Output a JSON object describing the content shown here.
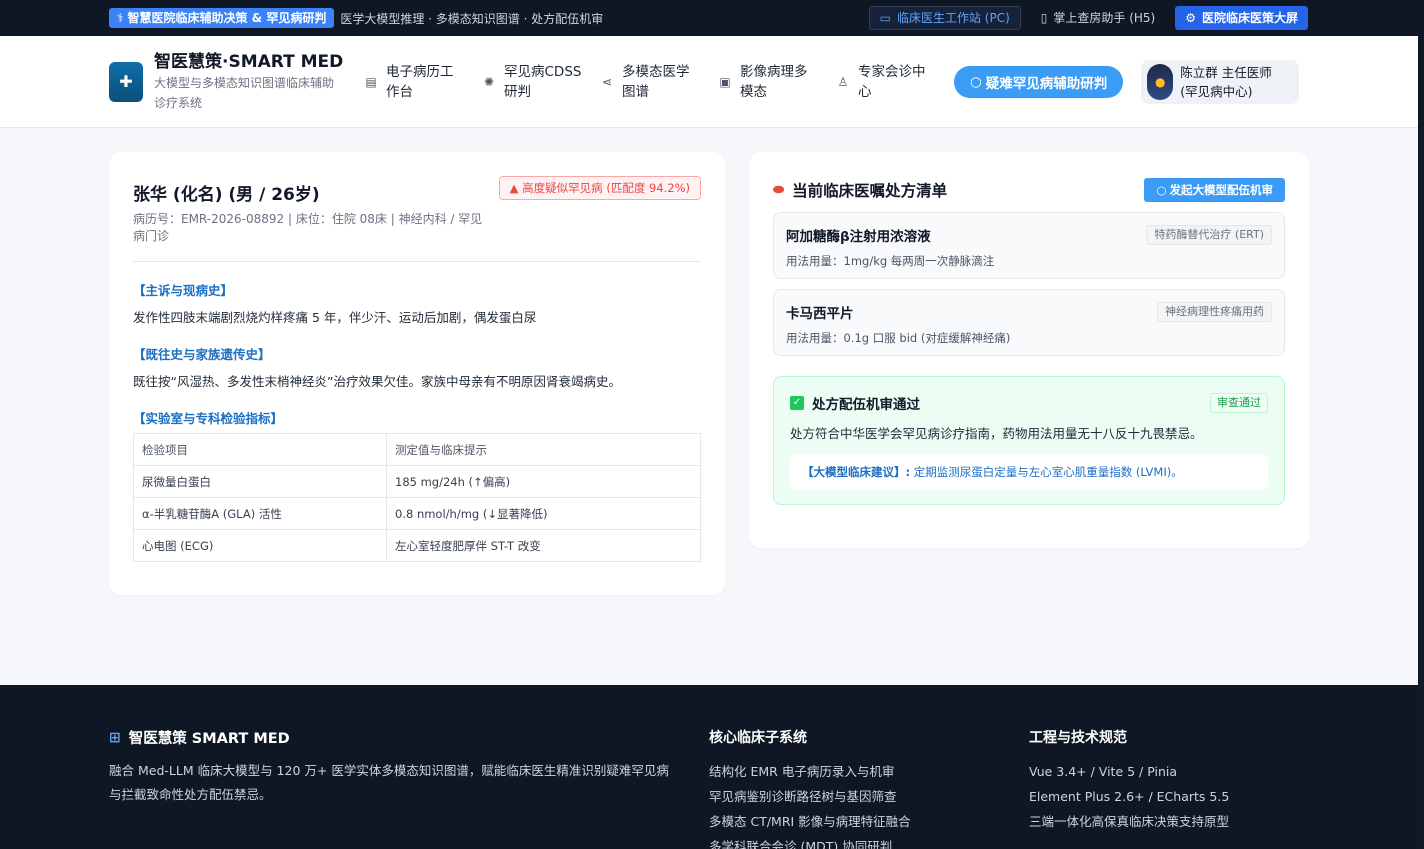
{
  "topbar": {
    "banner": "智慧医院临床辅助决策 & 罕见病研判",
    "tagline": "医学大模型推理 · 多模态知识图谱 · 处方配伍机审",
    "links": [
      {
        "label": "临床医生工作站 (PC)"
      },
      {
        "label": "掌上查房助手 (H5)"
      },
      {
        "label": "医院临床医策大屏"
      }
    ]
  },
  "header": {
    "title": "智医慧策·SMART MED",
    "subtitle": "大模型与多模态知识图谱临床辅助诊疗系统",
    "nav": [
      {
        "label": "电子病历工作台"
      },
      {
        "label": "罕见病CDSS研判"
      },
      {
        "label": "多模态医学图谱"
      },
      {
        "label": "影像病理多模态"
      },
      {
        "label": "专家会诊中心"
      }
    ],
    "cta": "疑难罕见病辅助研判",
    "user": {
      "name": "陈立群 主任医师",
      "dept": "(罕见病中心)"
    }
  },
  "patient": {
    "name": "张华 (化名) (男 / 26岁)",
    "meta": "病历号：EMR-2026-08892 | 床位：住院 08床 | 神经内科 / 罕见病门诊",
    "risk": "高度疑似罕见病 (匹配度 94.2%)",
    "sections": [
      {
        "title": "【主诉与现病史】",
        "body": "发作性四肢末端剧烈烧灼样疼痛 5 年，伴少汗、运动后加剧，偶发蛋白尿"
      },
      {
        "title": "【既往史与家族遗传史】",
        "body": "既往按“风湿热、多发性末梢神经炎”治疗效果欠佳。家族中母亲有不明原因肾衰竭病史。"
      }
    ],
    "lab_title": "【实验室与专科检验指标】",
    "lab_headers": [
      "检验项目",
      "测定值与临床提示"
    ],
    "lab_rows": [
      [
        "尿微量白蛋白",
        "185 mg/24h (↑偏高)"
      ],
      [
        "α-半乳糖苷酶A (GLA) 活性",
        "0.8 nmol/h/mg (↓显著降低)"
      ],
      [
        "心电图 (ECG)",
        "左心室轻度肥厚伴 ST-T 改变"
      ]
    ]
  },
  "prescription": {
    "title": "当前临床医嘱处方清单",
    "audit_button": "发起大模型配伍机审",
    "items": [
      {
        "name": "阿加糖酶β注射用浓溶液",
        "usage": "用法用量：1mg/kg 每两周一次静脉滴注",
        "tag": "特药酶替代治疗 (ERT)"
      },
      {
        "name": "卡马西平片",
        "usage": "用法用量：0.1g 口服 bid (对症缓解神经痛)",
        "tag": "神经病理性疼痛用药"
      }
    ],
    "pass": {
      "title": "处方配伍机审通过",
      "badge": "审查通过",
      "body": "处方符合中华医学会罕见病诊疗指南，药物用法用量无十八反十九畏禁忌。",
      "advice_label": "【大模型临床建议】:",
      "advice": "定期监测尿蛋白定量与左心室心肌重量指数 (LVMI)。"
    }
  },
  "footer": {
    "brand": "智医慧策 SMART MED",
    "desc": "融合 Med-LLM 临床大模型与 120 万+ 医学实体多模态知识图谱，赋能临床医生精准识别疑难罕见病与拦截致命性处方配伍禁忌。",
    "col1": {
      "title": "核心临床子系统",
      "items": [
        "结构化 EMR 电子病历录入与机审",
        "罕见病鉴别诊断路径树与基因筛查",
        "多模态 CT/MRI 影像与病理特征融合",
        "多学科联合会诊 (MDT) 协同研判"
      ]
    },
    "col2": {
      "title": "工程与技术规范",
      "items": [
        "Vue 3.4+ / Vite 5 / Pinia",
        "Element Plus 2.6+ / ECharts 5.5",
        "三端一体化高保真临床决策支持原型"
      ]
    }
  }
}
